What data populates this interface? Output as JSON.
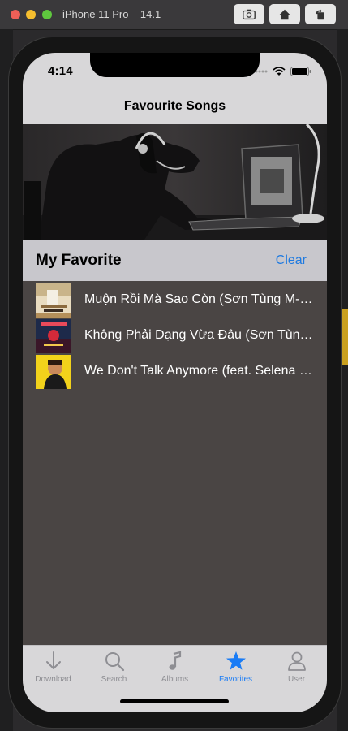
{
  "simulator": {
    "window_title": "iPhone 11 Pro – 14.1"
  },
  "status_bar": {
    "time": "4:14"
  },
  "nav": {
    "title": "Favourite Songs"
  },
  "section": {
    "title": "My Favorite",
    "clear_label": "Clear"
  },
  "songs": [
    {
      "title": "Muộn Rồi Mà Sao Còn (Sơn Tùng M-TP)"
    },
    {
      "title": "Không Phải Dạng Vừa Đâu (Sơn Tùng M-TP)"
    },
    {
      "title": "We Don't Talk Anymore (feat. Selena Gomez)"
    }
  ],
  "tabs": [
    {
      "label": "Download",
      "icon": "download-icon",
      "active": false
    },
    {
      "label": "Search",
      "icon": "search-icon",
      "active": false
    },
    {
      "label": "Albums",
      "icon": "music-note-icon",
      "active": false
    },
    {
      "label": "Favorites",
      "icon": "star-icon",
      "active": true
    },
    {
      "label": "User",
      "icon": "user-icon",
      "active": false
    }
  ],
  "colors": {
    "accent": "#1a7cf5",
    "clear": "#1f7ae0",
    "list_background": "#4a4544",
    "header_background": "#c8c7cc",
    "bar_background": "#d8d7d9"
  }
}
